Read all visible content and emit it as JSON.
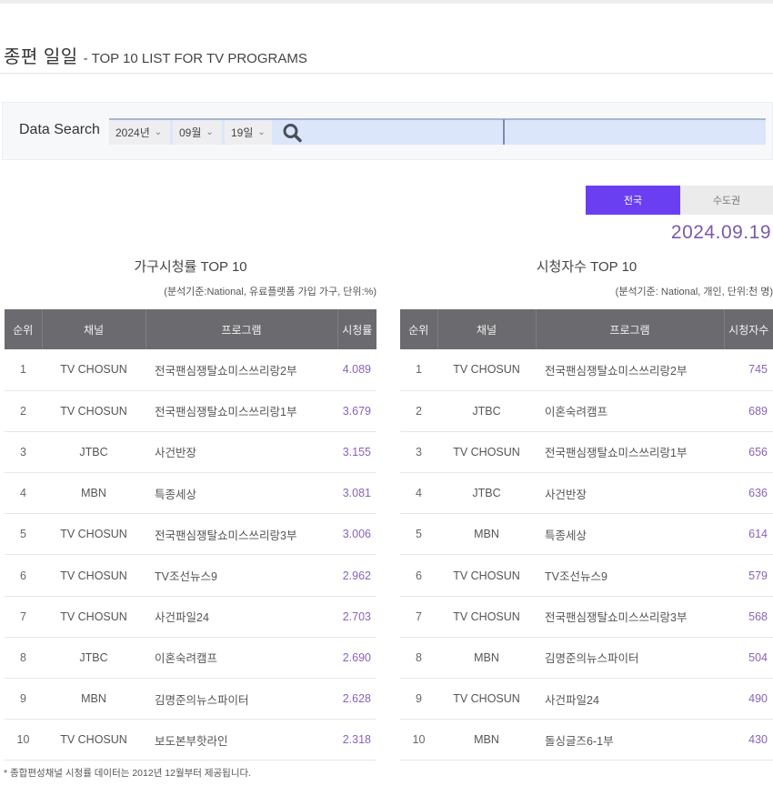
{
  "page": {
    "title_ko": "종편 일일",
    "title_en": "- TOP 10 LIST FOR TV PROGRAMS"
  },
  "search": {
    "label": "Data Search",
    "year": "2024년",
    "month": "09월",
    "day": "19일",
    "search_icon": "search-icon",
    "input_value": ""
  },
  "region_tabs": [
    {
      "label": "전국",
      "active": true
    },
    {
      "label": "수도권",
      "active": false
    }
  ],
  "date_display": "2024.09.19",
  "colors": {
    "accent_purple": "#6a3ff2",
    "value_purple": "#8a63b8",
    "header_gray": "#6b6b6f"
  },
  "household": {
    "title": "가구시청률 TOP 10",
    "note": "(분석기준:National, 유료플랫폼 가입 가구, 단위:%)",
    "headers": [
      "순위",
      "채널",
      "프로그램",
      "시청률"
    ],
    "rows": [
      {
        "rank": "1",
        "channel": "TV CHOSUN",
        "program": "전국팬심쟁탈쇼미스쓰리랑2부",
        "value": "4.089"
      },
      {
        "rank": "2",
        "channel": "TV CHOSUN",
        "program": "전국팬심쟁탈쇼미스쓰리랑1부",
        "value": "3.679"
      },
      {
        "rank": "3",
        "channel": "JTBC",
        "program": "사건반장",
        "value": "3.155"
      },
      {
        "rank": "4",
        "channel": "MBN",
        "program": "특종세상",
        "value": "3.081"
      },
      {
        "rank": "5",
        "channel": "TV CHOSUN",
        "program": "전국팬심쟁탈쇼미스쓰리랑3부",
        "value": "3.006"
      },
      {
        "rank": "6",
        "channel": "TV CHOSUN",
        "program": "TV조선뉴스9",
        "value": "2.962"
      },
      {
        "rank": "7",
        "channel": "TV CHOSUN",
        "program": "사건파일24",
        "value": "2.703"
      },
      {
        "rank": "8",
        "channel": "JTBC",
        "program": "이혼숙려캠프",
        "value": "2.690"
      },
      {
        "rank": "9",
        "channel": "MBN",
        "program": "김명준의뉴스파이터",
        "value": "2.628"
      },
      {
        "rank": "10",
        "channel": "TV CHOSUN",
        "program": "보도본부핫라인",
        "value": "2.318"
      }
    ]
  },
  "viewers": {
    "title": "시청자수 TOP 10",
    "note": "(분석기준: National, 개인, 단위:천 명)",
    "headers": [
      "순위",
      "채널",
      "프로그램",
      "시청자수"
    ],
    "rows": [
      {
        "rank": "1",
        "channel": "TV CHOSUN",
        "program": "전국팬심쟁탈쇼미스쓰리랑2부",
        "value": "745"
      },
      {
        "rank": "2",
        "channel": "JTBC",
        "program": "이혼숙려캠프",
        "value": "689"
      },
      {
        "rank": "3",
        "channel": "TV CHOSUN",
        "program": "전국팬심쟁탈쇼미스쓰리랑1부",
        "value": "656"
      },
      {
        "rank": "4",
        "channel": "JTBC",
        "program": "사건반장",
        "value": "636"
      },
      {
        "rank": "5",
        "channel": "MBN",
        "program": "특종세상",
        "value": "614"
      },
      {
        "rank": "6",
        "channel": "TV CHOSUN",
        "program": "TV조선뉴스9",
        "value": "579"
      },
      {
        "rank": "7",
        "channel": "TV CHOSUN",
        "program": "전국팬심쟁탈쇼미스쓰리랑3부",
        "value": "568"
      },
      {
        "rank": "8",
        "channel": "MBN",
        "program": "김명준의뉴스파이터",
        "value": "504"
      },
      {
        "rank": "9",
        "channel": "TV CHOSUN",
        "program": "사건파일24",
        "value": "490"
      },
      {
        "rank": "10",
        "channel": "MBN",
        "program": "돌싱글즈6-1부",
        "value": "430"
      }
    ]
  },
  "footnote": "* 종합편성채널 시청률 데이터는 2012년 12월부터 제공됩니다."
}
